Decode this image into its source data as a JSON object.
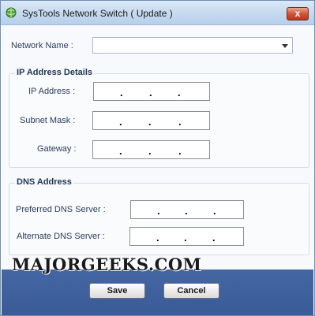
{
  "window": {
    "title": "SysTools Network Switch ( Update )",
    "close_glyph": "x"
  },
  "network": {
    "label": "Network Name :",
    "value": ""
  },
  "ip_section": {
    "title": "IP Address Details",
    "ip_label": "IP Address :",
    "subnet_label": "Subnet Mask :",
    "gateway_label": "Gateway :"
  },
  "dns_section": {
    "title": "DNS Address",
    "preferred_label": "Preferred DNS Server :",
    "alternate_label": "Alternate DNS Server :"
  },
  "ip_dot": ".",
  "watermark": "MAJORGEEKS.COM",
  "buttons": {
    "save": "Save",
    "cancel": "Cancel"
  },
  "colors": {
    "footer": "#3f619e",
    "titlebar": "#c5d9ef",
    "close": "#c9452b"
  },
  "icons": {
    "app": "network-globe-icon",
    "close": "close-icon",
    "dropdown": "chevron-down-icon"
  }
}
